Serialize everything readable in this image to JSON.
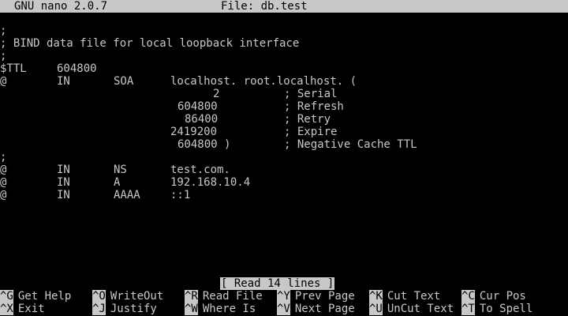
{
  "title_bar": {
    "app": "GNU nano 2.0.7",
    "file": "File: db.test"
  },
  "editor": {
    "l1": ";",
    "l2": "; BIND data file for local loopback interface",
    "l3": ";",
    "ttl": {
      "c1": "$TTL",
      "c2": "604800"
    },
    "soa": {
      "c1": "@",
      "c2": "IN",
      "c3": "SOA",
      "c4": "localhost. root.localhost. ("
    },
    "serial": {
      "v": "2",
      "c": "; Serial"
    },
    "refresh": {
      "v": "604800",
      "c": "; Refresh"
    },
    "retry": {
      "v": "86400",
      "c": "; Retry"
    },
    "expire": {
      "v": "2419200",
      "c": "; Expire"
    },
    "neg": {
      "v": "604800 )",
      "c": "; Negative Cache TTL"
    },
    "l10": ";",
    "ns": {
      "c1": "@",
      "c2": "IN",
      "c3": "NS",
      "c4": "test.com."
    },
    "a": {
      "c1": "@",
      "c2": "IN",
      "c3": "A",
      "c4": "192.168.10.4"
    },
    "aaaa": {
      "c1": "@",
      "c2": "IN",
      "c3": "AAAA",
      "c4": "::1"
    }
  },
  "status": "[ Read 14 lines ]",
  "shortcuts": {
    "get_help": {
      "key": "^G",
      "label": "Get Help"
    },
    "exit": {
      "key": "^X",
      "label": "Exit"
    },
    "write_out": {
      "key": "^O",
      "label": "WriteOut"
    },
    "justify": {
      "key": "^J",
      "label": "Justify"
    },
    "read_file": {
      "key": "^R",
      "label": "Read File"
    },
    "where_is": {
      "key": "^W",
      "label": "Where Is"
    },
    "prev_page": {
      "key": "^Y",
      "label": "Prev Page"
    },
    "next_page": {
      "key": "^V",
      "label": "Next Page"
    },
    "cut_text": {
      "key": "^K",
      "label": "Cut Text"
    },
    "uncut_text": {
      "key": "^U",
      "label": "UnCut Text"
    },
    "cur_pos": {
      "key": "^C",
      "label": "Cur Pos"
    },
    "to_spell": {
      "key": "^T",
      "label": "To Spell"
    }
  }
}
